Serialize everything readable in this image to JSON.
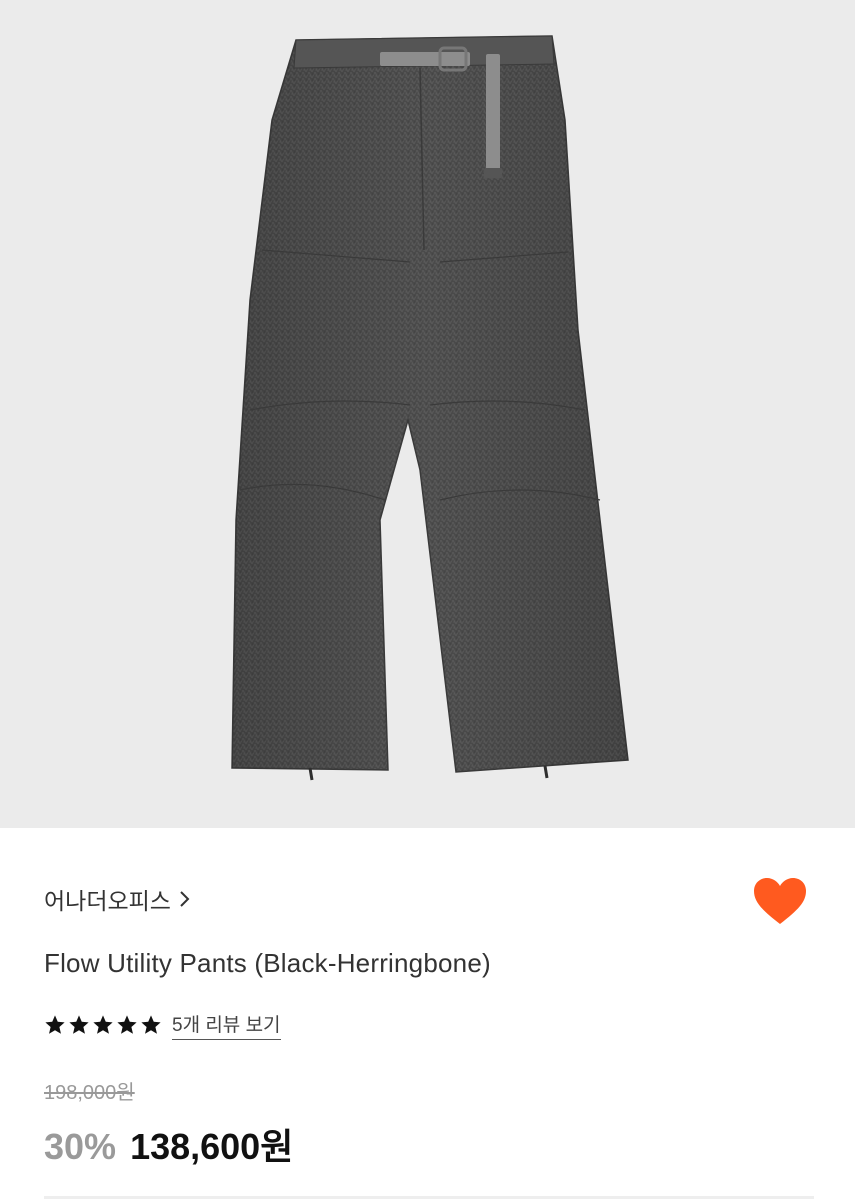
{
  "product": {
    "image_alt": "Flow Utility Pants (Black-Herringbone)",
    "brand": "어나더오피스",
    "title": "Flow Utility Pants (Black-Herringbone)",
    "rating": 5,
    "rating_max": 5,
    "review_link": "5개 리뷰 보기",
    "original_price": "198,000원",
    "discount": "30%",
    "sale_price": "138,600원",
    "wishlisted": true
  },
  "colors": {
    "accent": "#ff5a1f",
    "hero_bg": "#ebebeb",
    "fabric": "#4a4a4a"
  },
  "icons": {
    "brand_chevron": "chevron-right-icon",
    "wishlist": "heart-icon",
    "star": "star-icon"
  }
}
